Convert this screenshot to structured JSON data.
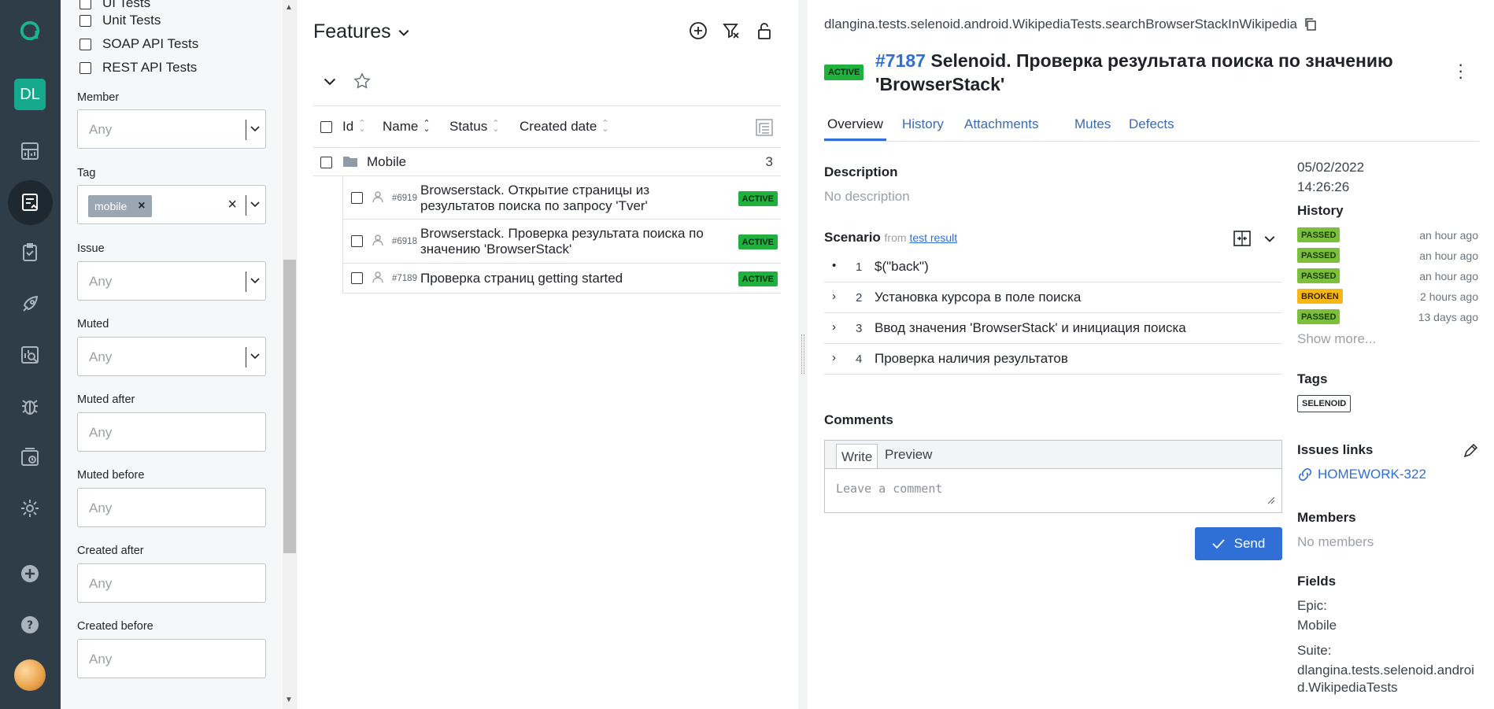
{
  "rail": {
    "user_initials": "DL"
  },
  "filters": {
    "checkboxes": [
      {
        "label": "Unit Tests"
      },
      {
        "label": "SOAP API Tests"
      },
      {
        "label": "REST API Tests"
      }
    ],
    "member": {
      "label": "Member",
      "placeholder": "Any"
    },
    "tag": {
      "label": "Tag",
      "chip": "mobile"
    },
    "issue": {
      "label": "Issue",
      "placeholder": "Any"
    },
    "muted": {
      "label": "Muted",
      "placeholder": "Any"
    },
    "muted_after": {
      "label": "Muted after",
      "placeholder": "Any"
    },
    "muted_before": {
      "label": "Muted before",
      "placeholder": "Any"
    },
    "created_after": {
      "label": "Created after",
      "placeholder": "Any"
    },
    "created_before": {
      "label": "Created before",
      "placeholder": "Any"
    }
  },
  "features": {
    "title": "Features",
    "columns": [
      "Id",
      "Name",
      "Status",
      "Created date"
    ],
    "group": {
      "name": "Mobile",
      "count": "3"
    },
    "rows": [
      {
        "id": "#6919",
        "name": "Browserstack. Открытие страницы из результатов поиска по запросу 'Tver'",
        "status": "ACTIVE"
      },
      {
        "id": "#6918",
        "name": "Browserstack. Проверка результата поиска по значению 'BrowserStack'",
        "status": "ACTIVE"
      },
      {
        "id": "#7189",
        "name": "Проверка страниц getting started",
        "status": "ACTIVE"
      }
    ]
  },
  "detail": {
    "fullpath": "dlangina.tests.selenoid.android.WikipediaTests.searchBrowserStackInWikipedia",
    "status": "ACTIVE",
    "number": "#7187",
    "title": "Selenoid. Проверка результата поиска по значению 'BrowserStack'",
    "tabs": [
      "Overview",
      "History",
      "Attachments",
      "Mutes",
      "Defects"
    ],
    "description_label": "Description",
    "description_value": "No description",
    "scenario_label": "Scenario",
    "scenario_from": "from",
    "scenario_link": "test result",
    "steps": [
      {
        "n": "1",
        "text": "$(\"back\")"
      },
      {
        "n": "2",
        "text": "Установка курсора в поле поиска"
      },
      {
        "n": "3",
        "text": "Ввод значения 'BrowserStack' и инициация поиска"
      },
      {
        "n": "4",
        "text": "Проверка наличия результатов"
      }
    ],
    "comments_label": "Comments",
    "comment_tabs": [
      "Write",
      "Preview"
    ],
    "comment_placeholder": "Leave a comment",
    "send_label": "Send",
    "date": "05/02/2022",
    "time": "14:26:26",
    "history_label": "History",
    "history": [
      {
        "status": "PASSED",
        "ago": "an hour ago"
      },
      {
        "status": "PASSED",
        "ago": "an hour ago"
      },
      {
        "status": "PASSED",
        "ago": "an hour ago"
      },
      {
        "status": "BROKEN",
        "ago": "2 hours ago"
      },
      {
        "status": "PASSED",
        "ago": "13 days ago"
      }
    ],
    "show_more": "Show more...",
    "tags_label": "Tags",
    "tag": "SELENOID",
    "issues_label": "Issues links",
    "issue_link": "HOMEWORK-322",
    "members_label": "Members",
    "members_value": "No members",
    "fields_label": "Fields",
    "epic_label": "Epic:",
    "epic_value": "Mobile",
    "suite_label": "Suite:",
    "suite_value": "dlangina.tests.selenoid.android.WikipediaTests"
  }
}
